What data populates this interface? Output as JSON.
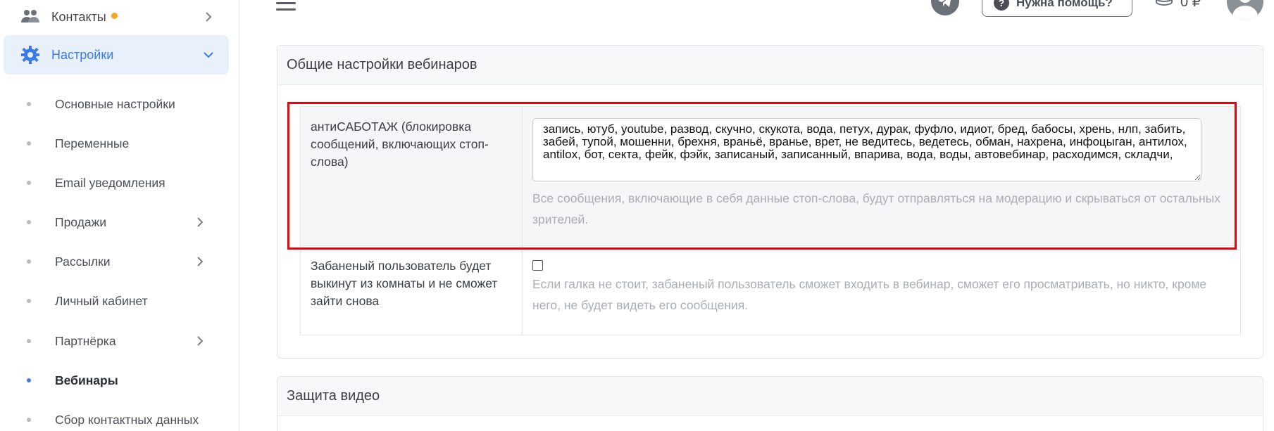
{
  "sidebar": {
    "contacts_label": "Контакты",
    "settings_label": "Настройки",
    "sub_items": [
      {
        "label": "Основные настройки"
      },
      {
        "label": "Переменные"
      },
      {
        "label": "Email уведомления"
      },
      {
        "label": "Продажи"
      },
      {
        "label": "Рассылки"
      },
      {
        "label": "Личный кабинет"
      },
      {
        "label": "Партнёрка"
      },
      {
        "label": "Вебинары"
      },
      {
        "label": "Сбор контактных данных"
      }
    ]
  },
  "header": {
    "help_label": "Нужна помощь?",
    "balance": "0 ₽"
  },
  "webinar_settings": {
    "title": "Общие настройки вебинаров",
    "antisabotage": {
      "label": "антиСАБОТАЖ (блокировка сообщений, включающих стоп-слова)",
      "value": "запись, ютуб, youtube, развод, скучно, скукота, вода, петух, дурак, фуфло, идиот, бред, бабосы, хрень, нлп, забить, забей, тупой, мошенни, брехня, враньё, вранье, врет, не ведитесь, ведетесь, обман, нахрена, инфоцыган, антилох, antilox, бот, секта, фейк, фэйк, записаный, записанный, впарива, вода, воды, автовебинар, расходимся, складчи,",
      "hint": "Все сообщения, включающие в себя данные стоп-слова, будут отправляться на модерацию и скрываться от остальных зрителей."
    },
    "ban": {
      "label": "Забаненый пользователь будет выкинут из комнаты и не сможет зайти снова",
      "hint": "Если галка не стоит, забаненый пользователь сможет входить в вебинар, сможет его просматривать, но никто, кроме него, не будет видеть его сообщения.",
      "checked": false
    }
  },
  "video_protection": {
    "title": "Защита видео"
  },
  "colors": {
    "accent": "#3b7be8",
    "highlight_border": "#e1060b",
    "notification_dot": "#f5a623"
  }
}
